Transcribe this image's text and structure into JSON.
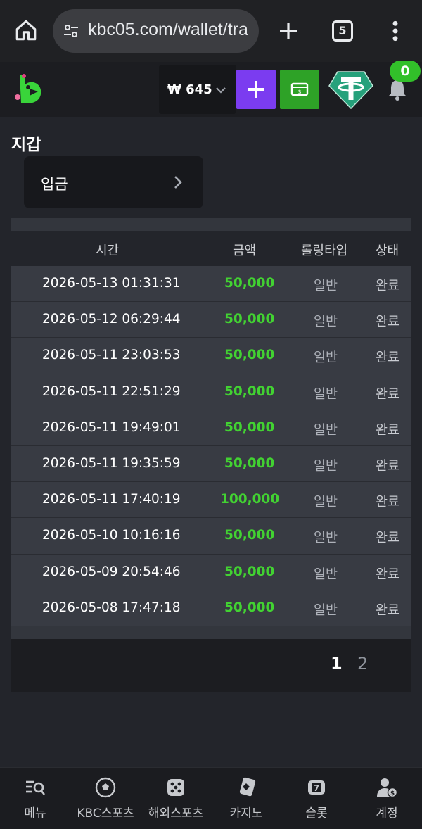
{
  "browser": {
    "url": "kbc05.com/wallet/tra",
    "tab_count": "5"
  },
  "header": {
    "balance": "₩ 645",
    "notification_count": "0"
  },
  "page": {
    "title": "지갑",
    "deposit_label": "입금"
  },
  "table": {
    "headers": [
      "시간",
      "금액",
      "롤링타입",
      "상태"
    ],
    "rows": [
      {
        "time": "2026-05-13 01:31:31",
        "amount": "50,000",
        "type": "일반",
        "status": "완료"
      },
      {
        "time": "2026-05-12 06:29:44",
        "amount": "50,000",
        "type": "일반",
        "status": "완료"
      },
      {
        "time": "2026-05-11 23:03:53",
        "amount": "50,000",
        "type": "일반",
        "status": "완료"
      },
      {
        "time": "2026-05-11 22:51:29",
        "amount": "50,000",
        "type": "일반",
        "status": "완료"
      },
      {
        "time": "2026-05-11 19:49:01",
        "amount": "50,000",
        "type": "일반",
        "status": "완료"
      },
      {
        "time": "2026-05-11 19:35:59",
        "amount": "50,000",
        "type": "일반",
        "status": "완료"
      },
      {
        "time": "2026-05-11 17:40:19",
        "amount": "100,000",
        "type": "일반",
        "status": "완료"
      },
      {
        "time": "2026-05-10 10:16:16",
        "amount": "50,000",
        "type": "일반",
        "status": "완료"
      },
      {
        "time": "2026-05-09 20:54:46",
        "amount": "50,000",
        "type": "일반",
        "status": "완료"
      },
      {
        "time": "2026-05-08 17:47:18",
        "amount": "50,000",
        "type": "일반",
        "status": "완료"
      }
    ]
  },
  "pagination": {
    "pages": [
      "1",
      "2"
    ],
    "current": "1"
  },
  "bottom_nav": {
    "items": [
      {
        "label": "메뉴",
        "icon": "menu-search-icon"
      },
      {
        "label": "KBC스포츠",
        "icon": "soccer-ball-icon"
      },
      {
        "label": "해외스포츠",
        "icon": "dice-icon"
      },
      {
        "label": "카지노",
        "icon": "card-icon"
      },
      {
        "label": "슬롯",
        "icon": "slot-seven-icon"
      },
      {
        "label": "계정",
        "icon": "account-icon"
      }
    ]
  },
  "colors": {
    "accent_green": "#42d232",
    "purple": "#7b3cf0",
    "cash_green": "#2ea227",
    "tether": "#26a17b"
  }
}
